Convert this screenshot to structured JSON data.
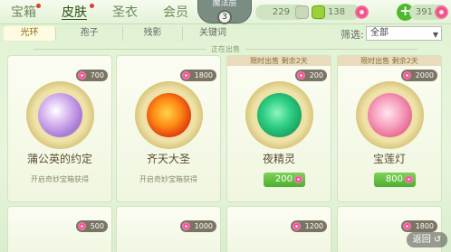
{
  "nav": {
    "tabs": [
      "宝箱",
      "皮肤",
      "圣衣",
      "会员"
    ],
    "active_index": 1
  },
  "level": {
    "label": "魔法层",
    "value": "3"
  },
  "resources": {
    "coins": "229",
    "gems": "138",
    "candy": "391",
    "plus": "+"
  },
  "subtabs": {
    "items": [
      "光环",
      "孢子",
      "残影",
      "关键词"
    ],
    "active_index": 0
  },
  "filter": {
    "label": "筛选:",
    "selected": "全部"
  },
  "section": {
    "label": "正在出售"
  },
  "cards": [
    {
      "name": "蒲公英的约定",
      "price": "700",
      "source": "开启奇妙宝箱获得",
      "banner": "",
      "buy": "",
      "orb_color": "#c99adf"
    },
    {
      "name": "齐天大圣",
      "price": "1800",
      "source": "开启奇妙宝箱获得",
      "banner": "",
      "buy": "",
      "orb_color": "#e8511c"
    },
    {
      "name": "夜精灵",
      "price": "200",
      "source": "",
      "banner": "限时出售 剩余2天",
      "buy": "200",
      "orb_color": "#2fc27a"
    },
    {
      "name": "宝莲灯",
      "price": "2000",
      "source": "",
      "banner": "限时出售 剩余2天",
      "buy": "800",
      "orb_color": "#f08ba8"
    }
  ],
  "bottom_cards": [
    {
      "price": "500"
    },
    {
      "price": "1000"
    },
    {
      "price": "1200"
    },
    {
      "price": "1800"
    }
  ],
  "back": {
    "label": "返回"
  },
  "colors": {
    "accent_green": "#4fb82e",
    "candy_pink": "#e8457a"
  }
}
